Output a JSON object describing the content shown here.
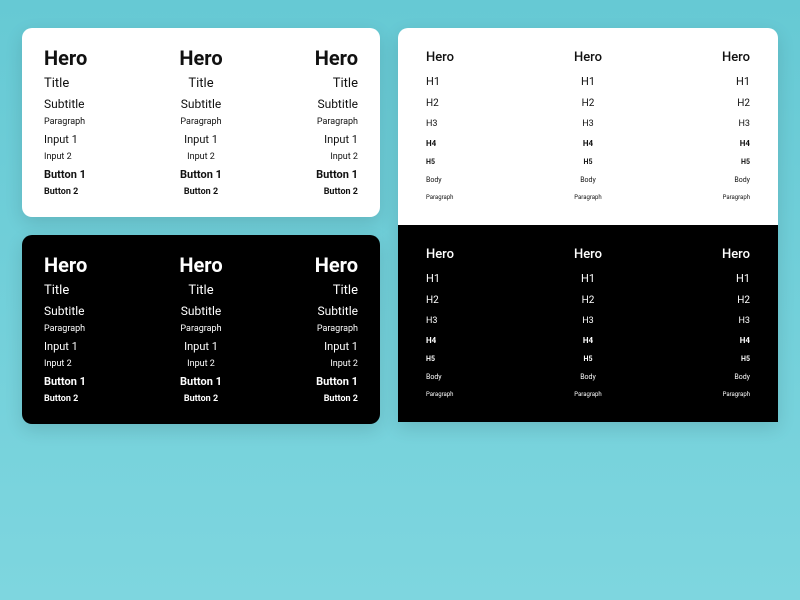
{
  "left": {
    "hero": "Hero",
    "title": "Title",
    "subtitle": "Subtitle",
    "paragraph": "Paragraph",
    "input1": "Input 1",
    "input2": "Input 2",
    "button1": "Button 1",
    "button2": "Button 2"
  },
  "right": {
    "hero": "Hero",
    "h1": "H1",
    "h2": "H2",
    "h3": "H3",
    "h4": "H4",
    "h5": "H5",
    "body": "Body",
    "paragraph": "Paragraph"
  }
}
